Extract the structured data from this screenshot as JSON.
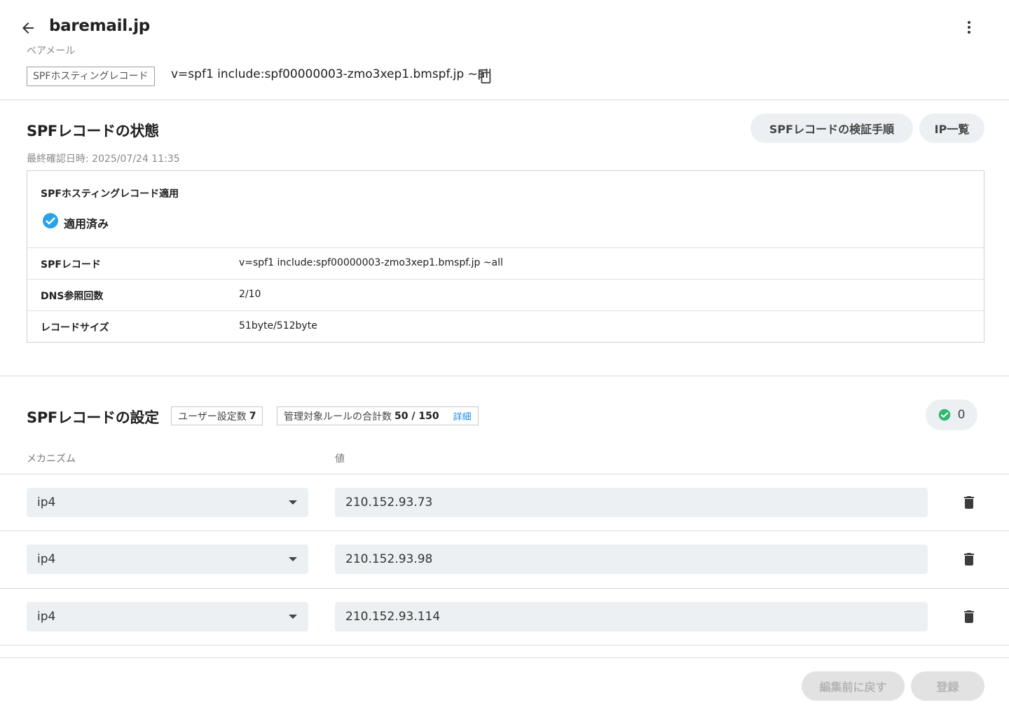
{
  "header": {
    "title": "baremail.jp",
    "subtitle": "ベアメール",
    "spf_tag": "SPFホスティングレコード",
    "spf_record": "v=spf1 include:spf00000003-zmo3xep1.bmspf.jp ~all"
  },
  "status": {
    "title": "SPFレコードの状態",
    "verify_button": "SPFレコードの検証手順",
    "ip_list_button": "IP一覧",
    "last_checked": "最終確認日時: 2025/07/24 11:35",
    "hosting_label": "SPFホスティングレコード適用",
    "applied_label": "適用済み",
    "rows": [
      {
        "label": "SPFレコード",
        "value": "v=spf1 include:spf00000003-zmo3xep1.bmspf.jp ~all"
      },
      {
        "label": "DNS参照回数",
        "value": "2/10"
      },
      {
        "label": "レコードサイズ",
        "value": "51byte/512byte"
      }
    ]
  },
  "settings": {
    "title": "SPFレコードの設定",
    "user_count_label": "ユーザー設定数",
    "user_count": "7",
    "rules_label": "管理対象ルールの合計数",
    "rules_count": "50 / 150",
    "detail_link": "詳細",
    "ok_count": "0",
    "col_mechanism": "メカニズム",
    "col_value": "値",
    "rows": [
      {
        "mechanism": "ip4",
        "value": "210.152.93.73"
      },
      {
        "mechanism": "ip4",
        "value": "210.152.93.98"
      },
      {
        "mechanism": "ip4",
        "value": "210.152.93.114"
      }
    ]
  },
  "footer": {
    "revert_button": "編集前に戻す",
    "register_button": "登録"
  },
  "colors": {
    "accent_blue": "#1e88e5",
    "check_blue": "#29a3e6",
    "ok_green": "#2eb872",
    "pill_bg": "#edf0f2"
  }
}
